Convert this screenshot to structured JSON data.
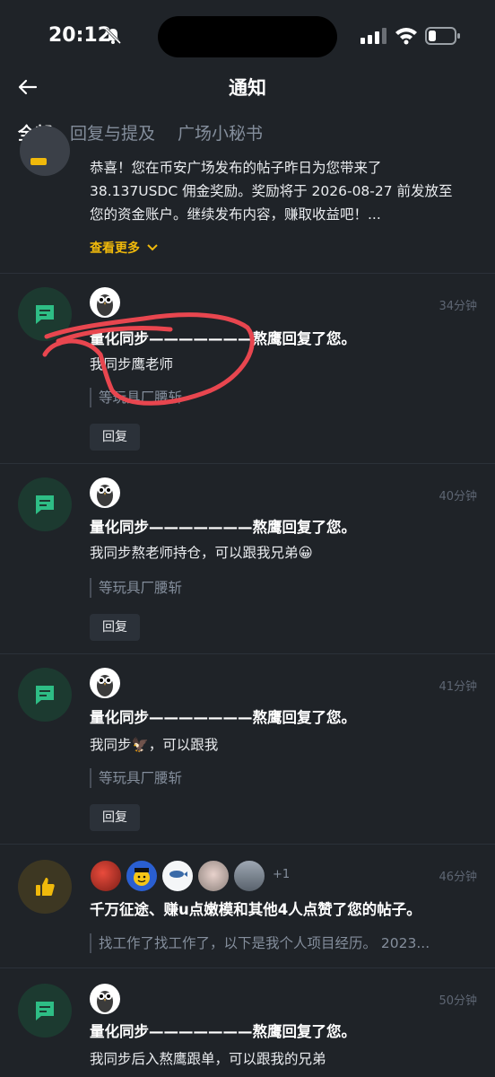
{
  "status_bar": {
    "time": "20:12"
  },
  "header": {
    "title": "通知"
  },
  "tabs": [
    "全部",
    "回复与提及",
    "广场小秘书"
  ],
  "first_item": {
    "body": "恭喜！您在币安广场发布的帖子昨日为您带来了 38.137USDC 佣金奖励。奖励将于 2026-08-27 前发放至您的资金账户。继续发布内容，赚取收益吧！...",
    "more_label": "查看更多"
  },
  "notifications": [
    {
      "ago": "34分钟",
      "headline": "量化同步———————熬鹰回复了您。",
      "message": "我同步鹰老师",
      "quote": "等玩具厂腰斩",
      "reply_label": "回复"
    },
    {
      "ago": "40分钟",
      "headline": "量化同步———————熬鹰回复了您。",
      "message": "我同步熬老师持仓，可以跟我兄弟😀",
      "quote": "等玩具厂腰斩",
      "reply_label": "回复"
    },
    {
      "ago": "41分钟",
      "headline": "量化同步———————熬鹰回复了您。",
      "message": "我同步🦅，可以跟我",
      "quote": "等玩具厂腰斩",
      "reply_label": "回复"
    },
    {
      "ago": "46分钟",
      "headline": "千万征途、赚u点嫩模和其他4人点赞了您的帖子。",
      "extra_count": "+1",
      "quote": "找工作了找工作了，以下是我个人项目经历。 2023..."
    },
    {
      "ago": "50分钟",
      "headline": "量化同步———————熬鹰回复了您。",
      "message": "我同步后入熬鹰跟单，可以跟我的兄弟"
    }
  ],
  "colors": {
    "background": "#1f2328",
    "accent": "#f0b90b",
    "reply_icon": "#2ebd85",
    "annotation": "#e8464f"
  }
}
